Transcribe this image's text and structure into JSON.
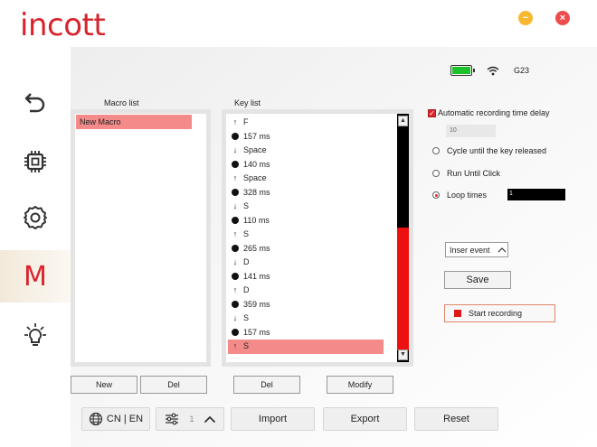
{
  "app": {
    "logo": "incott"
  },
  "window": {
    "minimize_icon": "minimize-icon",
    "close_icon": "close-icon",
    "minimize_color": "#f7b731",
    "close_color": "#ee4c4c"
  },
  "status": {
    "battery_level": 1.0,
    "battery_color": "#1dc22a",
    "device_name": "G23"
  },
  "sidebar": {
    "items": [
      {
        "name": "back",
        "icon": "back-arrow-icon"
      },
      {
        "name": "chip",
        "icon": "chip-icon"
      },
      {
        "name": "settings",
        "icon": "gear-icon"
      },
      {
        "name": "macro",
        "label": "M",
        "active": true
      },
      {
        "name": "lighting",
        "icon": "bulb-icon"
      }
    ]
  },
  "macro_list": {
    "label": "Macro list",
    "items": [
      {
        "name": "New Macro",
        "selected": true
      }
    ],
    "new_label": "New",
    "del_label": "Del"
  },
  "key_list": {
    "label": "Key list",
    "rows": [
      {
        "type": "up",
        "text": "F"
      },
      {
        "type": "delay",
        "text": "157 ms"
      },
      {
        "type": "down",
        "text": "Space"
      },
      {
        "type": "delay",
        "text": "140 ms"
      },
      {
        "type": "up",
        "text": "Space"
      },
      {
        "type": "delay",
        "text": "328 ms"
      },
      {
        "type": "down",
        "text": "S"
      },
      {
        "type": "delay",
        "text": "110 ms"
      },
      {
        "type": "up",
        "text": "S"
      },
      {
        "type": "delay",
        "text": "265 ms"
      },
      {
        "type": "down",
        "text": "D"
      },
      {
        "type": "delay",
        "text": "141 ms"
      },
      {
        "type": "up",
        "text": "D"
      },
      {
        "type": "delay",
        "text": "359 ms"
      },
      {
        "type": "down",
        "text": "S"
      },
      {
        "type": "delay",
        "text": "157 ms"
      },
      {
        "type": "up",
        "text": "S",
        "selected": true
      }
    ],
    "del_label": "Del",
    "modify_label": "Modify"
  },
  "options": {
    "auto_delay_label": "Automatic recording time delay",
    "auto_delay_checked": true,
    "delay_value": "10",
    "cycle_label": "Cycle until the key released",
    "run_label": "Run Until Click",
    "loop_label": "Loop times",
    "loop_value": "1",
    "selected_mode": "loop",
    "insert_event_label": "Inser event",
    "save_label": "Save",
    "record_label": "Start recording",
    "record_color": "#e01818"
  },
  "bottom": {
    "lang_label": "CN | EN",
    "profile_number": "1",
    "import_label": "Import",
    "export_label": "Export",
    "reset_label": "Reset"
  }
}
